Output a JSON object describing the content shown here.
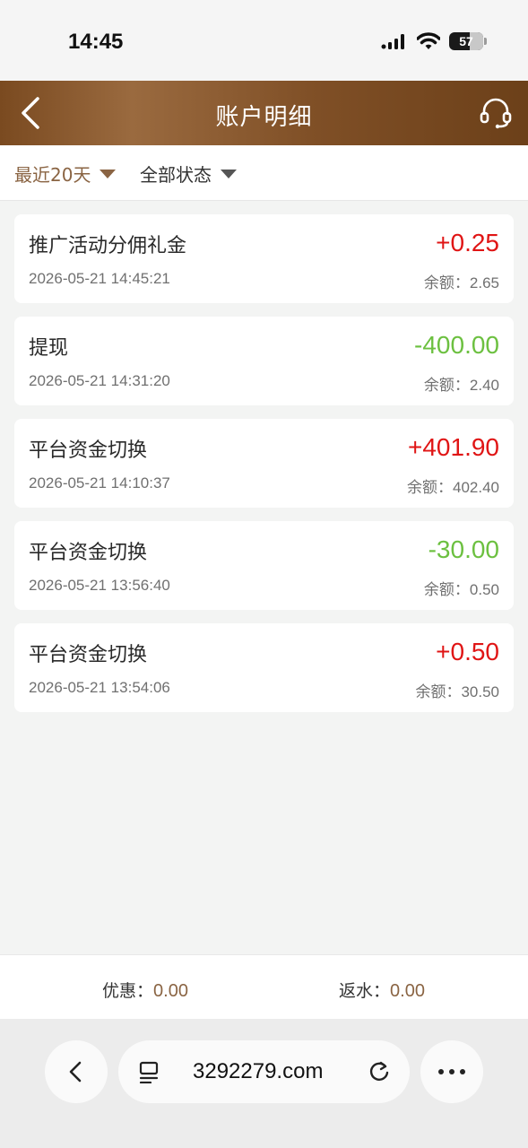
{
  "status_bar": {
    "time": "14:45",
    "battery": "57"
  },
  "header": {
    "title": "账户明细"
  },
  "filters": {
    "date_label": "最近20天",
    "status_label": "全部状态"
  },
  "transactions": [
    {
      "title": "推广活动分佣礼金",
      "time": "2026-05-21 14:45:21",
      "amount": "+0.25",
      "balance_label": "余额：",
      "balance": "2.65",
      "direction": "in"
    },
    {
      "title": "提现",
      "time": "2026-05-21 14:31:20",
      "amount": "-400.00",
      "balance_label": "余额：",
      "balance": "2.40",
      "direction": "out"
    },
    {
      "title": "平台资金切换",
      "time": "2026-05-21 14:10:37",
      "amount": "+401.90",
      "balance_label": "余额：",
      "balance": "402.40",
      "direction": "in"
    },
    {
      "title": "平台资金切换",
      "time": "2026-05-21 13:56:40",
      "amount": "-30.00",
      "balance_label": "余额：",
      "balance": "0.50",
      "direction": "out"
    },
    {
      "title": "平台资金切换",
      "time": "2026-05-21 13:54:06",
      "amount": "+0.50",
      "balance_label": "余额：",
      "balance": "30.50",
      "direction": "in"
    }
  ],
  "summary": {
    "discount_label": "优惠：",
    "discount_value": "0.00",
    "rebate_label": "返水：",
    "rebate_value": "0.00"
  },
  "browser": {
    "url": "3292279.com"
  },
  "colors": {
    "header_brown": "#7a4a20",
    "accent_brown": "#8a6443",
    "positive": "#e01515",
    "negative": "#6cc040"
  }
}
